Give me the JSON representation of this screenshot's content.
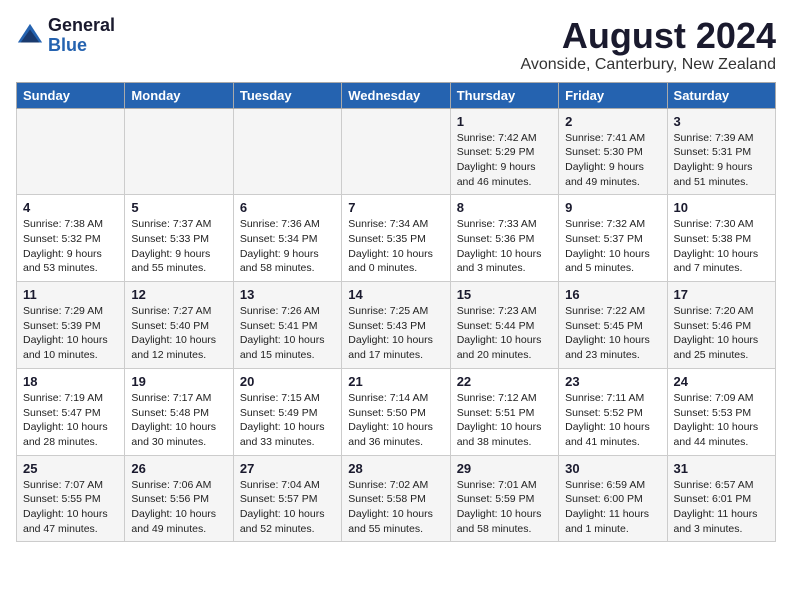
{
  "header": {
    "logo_general": "General",
    "logo_blue": "Blue",
    "title": "August 2024",
    "subtitle": "Avonside, Canterbury, New Zealand"
  },
  "days_of_week": [
    "Sunday",
    "Monday",
    "Tuesday",
    "Wednesday",
    "Thursday",
    "Friday",
    "Saturday"
  ],
  "weeks": [
    [
      {
        "day": "",
        "info": ""
      },
      {
        "day": "",
        "info": ""
      },
      {
        "day": "",
        "info": ""
      },
      {
        "day": "",
        "info": ""
      },
      {
        "day": "1",
        "info": "Sunrise: 7:42 AM\nSunset: 5:29 PM\nDaylight: 9 hours\nand 46 minutes."
      },
      {
        "day": "2",
        "info": "Sunrise: 7:41 AM\nSunset: 5:30 PM\nDaylight: 9 hours\nand 49 minutes."
      },
      {
        "day": "3",
        "info": "Sunrise: 7:39 AM\nSunset: 5:31 PM\nDaylight: 9 hours\nand 51 minutes."
      }
    ],
    [
      {
        "day": "4",
        "info": "Sunrise: 7:38 AM\nSunset: 5:32 PM\nDaylight: 9 hours\nand 53 minutes."
      },
      {
        "day": "5",
        "info": "Sunrise: 7:37 AM\nSunset: 5:33 PM\nDaylight: 9 hours\nand 55 minutes."
      },
      {
        "day": "6",
        "info": "Sunrise: 7:36 AM\nSunset: 5:34 PM\nDaylight: 9 hours\nand 58 minutes."
      },
      {
        "day": "7",
        "info": "Sunrise: 7:34 AM\nSunset: 5:35 PM\nDaylight: 10 hours\nand 0 minutes."
      },
      {
        "day": "8",
        "info": "Sunrise: 7:33 AM\nSunset: 5:36 PM\nDaylight: 10 hours\nand 3 minutes."
      },
      {
        "day": "9",
        "info": "Sunrise: 7:32 AM\nSunset: 5:37 PM\nDaylight: 10 hours\nand 5 minutes."
      },
      {
        "day": "10",
        "info": "Sunrise: 7:30 AM\nSunset: 5:38 PM\nDaylight: 10 hours\nand 7 minutes."
      }
    ],
    [
      {
        "day": "11",
        "info": "Sunrise: 7:29 AM\nSunset: 5:39 PM\nDaylight: 10 hours\nand 10 minutes."
      },
      {
        "day": "12",
        "info": "Sunrise: 7:27 AM\nSunset: 5:40 PM\nDaylight: 10 hours\nand 12 minutes."
      },
      {
        "day": "13",
        "info": "Sunrise: 7:26 AM\nSunset: 5:41 PM\nDaylight: 10 hours\nand 15 minutes."
      },
      {
        "day": "14",
        "info": "Sunrise: 7:25 AM\nSunset: 5:43 PM\nDaylight: 10 hours\nand 17 minutes."
      },
      {
        "day": "15",
        "info": "Sunrise: 7:23 AM\nSunset: 5:44 PM\nDaylight: 10 hours\nand 20 minutes."
      },
      {
        "day": "16",
        "info": "Sunrise: 7:22 AM\nSunset: 5:45 PM\nDaylight: 10 hours\nand 23 minutes."
      },
      {
        "day": "17",
        "info": "Sunrise: 7:20 AM\nSunset: 5:46 PM\nDaylight: 10 hours\nand 25 minutes."
      }
    ],
    [
      {
        "day": "18",
        "info": "Sunrise: 7:19 AM\nSunset: 5:47 PM\nDaylight: 10 hours\nand 28 minutes."
      },
      {
        "day": "19",
        "info": "Sunrise: 7:17 AM\nSunset: 5:48 PM\nDaylight: 10 hours\nand 30 minutes."
      },
      {
        "day": "20",
        "info": "Sunrise: 7:15 AM\nSunset: 5:49 PM\nDaylight: 10 hours\nand 33 minutes."
      },
      {
        "day": "21",
        "info": "Sunrise: 7:14 AM\nSunset: 5:50 PM\nDaylight: 10 hours\nand 36 minutes."
      },
      {
        "day": "22",
        "info": "Sunrise: 7:12 AM\nSunset: 5:51 PM\nDaylight: 10 hours\nand 38 minutes."
      },
      {
        "day": "23",
        "info": "Sunrise: 7:11 AM\nSunset: 5:52 PM\nDaylight: 10 hours\nand 41 minutes."
      },
      {
        "day": "24",
        "info": "Sunrise: 7:09 AM\nSunset: 5:53 PM\nDaylight: 10 hours\nand 44 minutes."
      }
    ],
    [
      {
        "day": "25",
        "info": "Sunrise: 7:07 AM\nSunset: 5:55 PM\nDaylight: 10 hours\nand 47 minutes."
      },
      {
        "day": "26",
        "info": "Sunrise: 7:06 AM\nSunset: 5:56 PM\nDaylight: 10 hours\nand 49 minutes."
      },
      {
        "day": "27",
        "info": "Sunrise: 7:04 AM\nSunset: 5:57 PM\nDaylight: 10 hours\nand 52 minutes."
      },
      {
        "day": "28",
        "info": "Sunrise: 7:02 AM\nSunset: 5:58 PM\nDaylight: 10 hours\nand 55 minutes."
      },
      {
        "day": "29",
        "info": "Sunrise: 7:01 AM\nSunset: 5:59 PM\nDaylight: 10 hours\nand 58 minutes."
      },
      {
        "day": "30",
        "info": "Sunrise: 6:59 AM\nSunset: 6:00 PM\nDaylight: 11 hours\nand 1 minute."
      },
      {
        "day": "31",
        "info": "Sunrise: 6:57 AM\nSunset: 6:01 PM\nDaylight: 11 hours\nand 3 minutes."
      }
    ]
  ]
}
